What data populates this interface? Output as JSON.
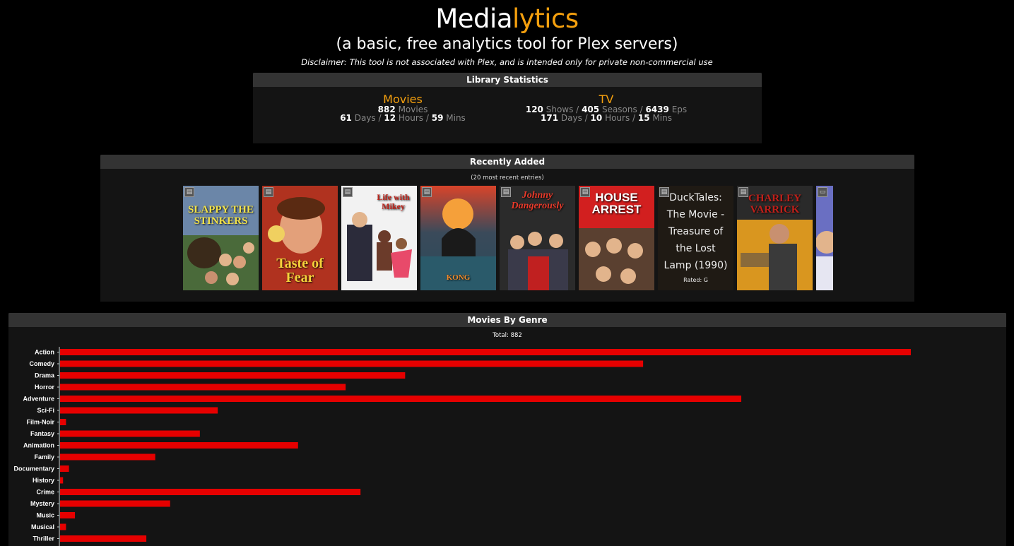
{
  "header": {
    "logo_white": "Media",
    "logo_orange": "lytics",
    "subtitle": "(a basic, free analytics tool for Plex servers)",
    "disclaimer": "Disclaimer: This tool is not associated with Plex, and is intended only for private non-commercial use"
  },
  "library": {
    "heading": "Library Statistics",
    "movies": {
      "title": "Movies",
      "count": "882",
      "count_unit": "Movies",
      "days": "61",
      "days_unit": "Days /",
      "hours": "12",
      "hours_unit": "Hours /",
      "mins": "59",
      "mins_unit": "Mins"
    },
    "tv": {
      "title": "TV",
      "shows": "120",
      "shows_unit": "Shows /",
      "seasons": "405",
      "seasons_unit": "Seasons /",
      "eps": "6439",
      "eps_unit": "Eps",
      "days": "171",
      "days_unit": "Days /",
      "hours": "10",
      "hours_unit": "Hours /",
      "mins": "15",
      "mins_unit": "Mins"
    }
  },
  "recent": {
    "heading": "Recently Added",
    "note": "(20 most recent entries)",
    "posters": [
      {
        "title": "SLAPPY THE STINKERS",
        "bg": "#6b86a8",
        "fg": "#f2e24a"
      },
      {
        "title": "Taste of Fear",
        "bg": "#b0321f",
        "fg": "#f5d23b"
      },
      {
        "title": "Life with Mikey",
        "bg": "#f2f2f2",
        "fg": "#c0251c"
      },
      {
        "title": "KONG",
        "bg": "#3a5a6a",
        "fg": "#f28a2a"
      },
      {
        "title": "Johnny Dangerously",
        "bg": "#2b2b2b",
        "fg": "#e93a2a"
      },
      {
        "title": "HOUSE ARREST",
        "bg": "#d21f1f",
        "fg": "#ffffff"
      },
      {
        "title": "DuckTales: The Movie - Treasure of the Lost Lamp (1990)",
        "rated": "Rated: G"
      },
      {
        "title": "CHARLEY VARRICK",
        "bg": "#d9961f",
        "fg": "#c0201a"
      },
      {
        "title": "",
        "bg": "#6a6fc2",
        "fg": "#ffffff"
      }
    ]
  },
  "genre": {
    "heading": "Movies By Genre",
    "total": "Total: 882"
  },
  "chart_data": {
    "type": "bar",
    "orientation": "horizontal",
    "categories": [
      "Action",
      "Comedy",
      "Drama",
      "Horror",
      "Adventure",
      "Sci-Fi",
      "Film-Noir",
      "Fantasy",
      "Animation",
      "Family",
      "Documentary",
      "History",
      "Crime",
      "Mystery",
      "Music",
      "Musical",
      "Thriller"
    ],
    "values": [
      286,
      196,
      116,
      96,
      229,
      53,
      2,
      47,
      80,
      32,
      3,
      1,
      101,
      37,
      5,
      2,
      29
    ],
    "color": "#e60000",
    "xlim": [
      0,
      300
    ],
    "title": "",
    "xlabel": "",
    "ylabel": ""
  }
}
